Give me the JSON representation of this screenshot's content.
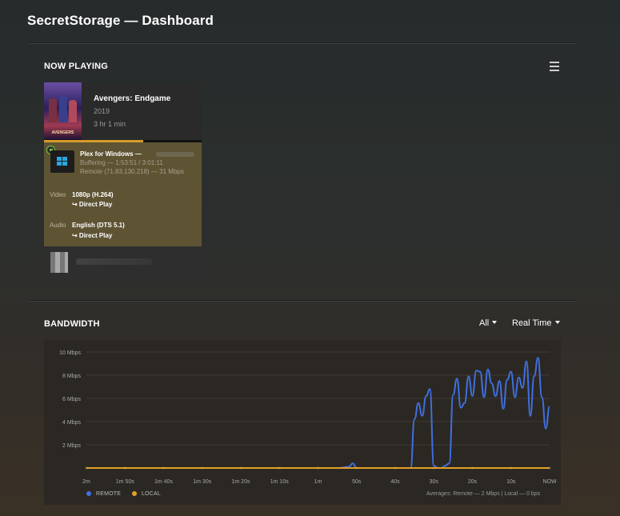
{
  "header": {
    "title": "SecretStorage — Dashboard"
  },
  "now_playing": {
    "section_title": "NOW PLAYING",
    "poster_text": "AVENGERS",
    "movie": {
      "title": "Avengers: Endgame",
      "year": "2019",
      "duration": "3 hr 1 min"
    },
    "progress_fraction": 0.63,
    "stream": {
      "player": "Plex for Windows  —",
      "state": "Buffering — 1:53:51 / 3:01:11",
      "remote": "Remote (71.83.130.218) — 31 Mbps",
      "video_label": "Video",
      "video_value": "1080p (H.264)",
      "video_mode": "↪   Direct Play",
      "audio_label": "Audio",
      "audio_value": "English (DTS 5.1)",
      "audio_mode": "↪   Direct Play"
    }
  },
  "bandwidth": {
    "section_title": "BANDWIDTH",
    "filter_label": "All",
    "range_label": "Real Time",
    "legend_remote": "REMOTE",
    "legend_local": "LOCAL",
    "averages": "Averages: Remote — 2 Mbps | Local — 0 bps"
  },
  "colors": {
    "remote": "#3f6fe0",
    "local": "#e3a027",
    "accent": "#d59b2a"
  },
  "chart_data": {
    "type": "line",
    "ylabel_ticks": [
      "",
      "2 Mbps",
      "4 Mbps",
      "6 Mbps",
      "8 Mbps",
      "10 Mbps"
    ],
    "ylim": [
      0,
      10
    ],
    "xlim": [
      120,
      0
    ],
    "x_tick_labels": [
      "2m",
      "1m 50s",
      "1m 40s",
      "1m 30s",
      "1m 20s",
      "1m 10s",
      "1m",
      "50s",
      "40s",
      "30s",
      "20s",
      "10s",
      "NOW"
    ],
    "x_tick_values": [
      120,
      110,
      100,
      90,
      80,
      70,
      60,
      50,
      40,
      30,
      20,
      10,
      0
    ],
    "grid": true,
    "legend": "bottom-left",
    "series": [
      {
        "name": "REMOTE",
        "color": "#3f6fe0",
        "x": [
          120,
          55,
          52,
          51,
          50,
          49,
          48,
          40,
          36,
          35,
          34,
          33,
          32,
          31,
          30,
          29,
          28,
          27,
          26,
          25,
          24,
          23,
          22,
          21,
          20,
          19,
          18,
          17,
          16,
          15,
          14,
          13,
          12,
          11,
          10,
          9,
          8,
          7,
          6,
          5,
          4,
          3,
          2,
          1,
          0
        ],
        "y": [
          0,
          0,
          0.1,
          0.4,
          0,
          0,
          0,
          0,
          0,
          4.2,
          5.6,
          4.5,
          6.2,
          6.8,
          0.2,
          0,
          0,
          0.2,
          0.4,
          6.3,
          7.7,
          5.2,
          5.6,
          7.9,
          6.2,
          8.4,
          8.3,
          6.1,
          8.5,
          7.3,
          6.2,
          7.5,
          5.1,
          7.6,
          8.3,
          6.1,
          7.8,
          6.9,
          9.2,
          4.5,
          7.9,
          9.5,
          6.1,
          3.4,
          5.3
        ]
      },
      {
        "name": "LOCAL",
        "color": "#e3a027",
        "x": [
          120,
          36,
          0
        ],
        "y": [
          0,
          0,
          0
        ]
      }
    ]
  }
}
